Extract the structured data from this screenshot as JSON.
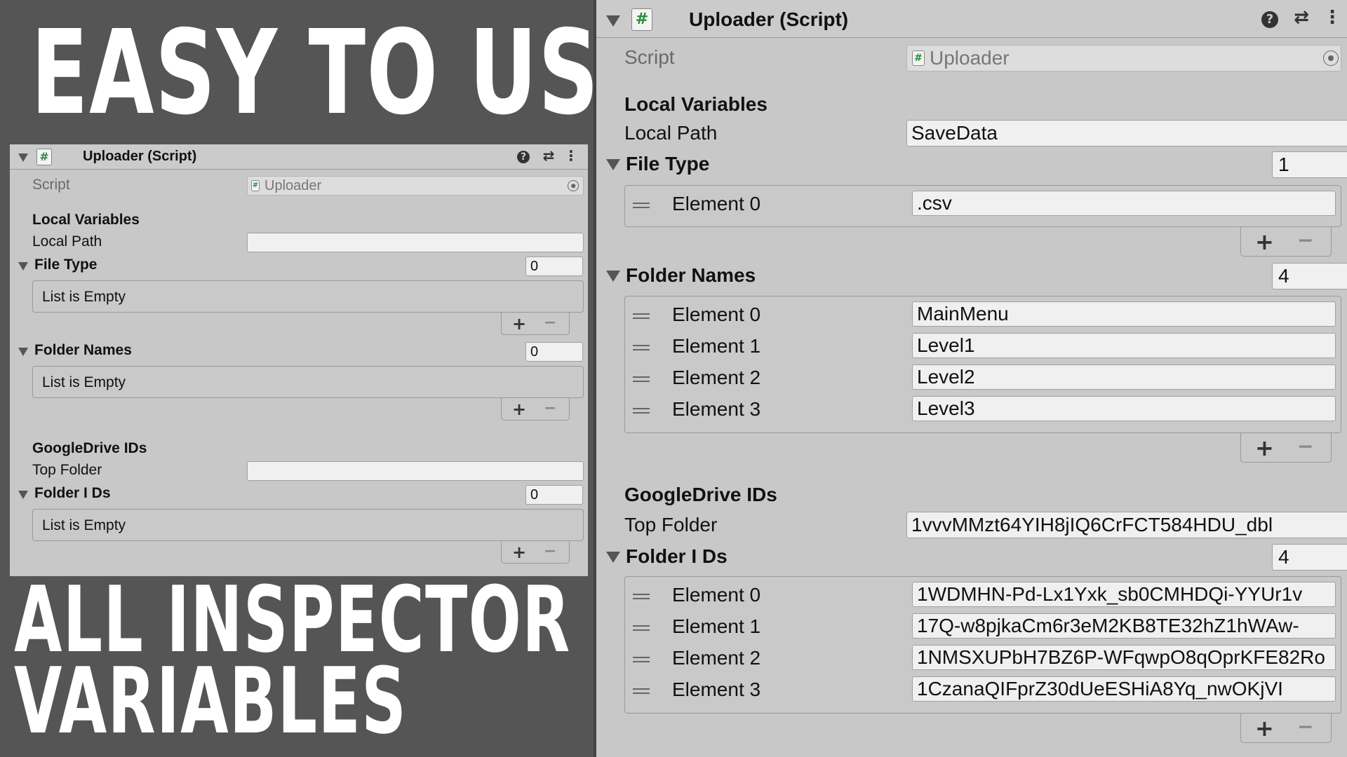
{
  "headline": {
    "line1": "EASY TO USE",
    "line2": "ALL INSPECTOR",
    "line3": "VARIABLES"
  },
  "small": {
    "component_title": "Uploader (Script)",
    "script_label": "Script",
    "script_value": "Uploader",
    "section_local": "Local Variables",
    "local_path_label": "Local Path",
    "local_path_value": "",
    "file_type_label": "File Type",
    "file_type_count": "0",
    "file_type_empty": "List is Empty",
    "folder_names_label": "Folder Names",
    "folder_names_count": "0",
    "folder_names_empty": "List is Empty",
    "section_drive": "GoogleDrive IDs",
    "top_folder_label": "Top Folder",
    "top_folder_value": "",
    "folder_ids_label": "Folder I Ds",
    "folder_ids_count": "0",
    "folder_ids_empty": "List is Empty",
    "plus": "+",
    "minus": "−"
  },
  "big": {
    "component_title": "Uploader (Script)",
    "script_label": "Script",
    "script_value": "Uploader",
    "section_local": "Local Variables",
    "local_path_label": "Local Path",
    "local_path_value": "SaveData",
    "file_type_label": "File Type",
    "file_type_count": "1",
    "file_type_elements": [
      {
        "label": "Element 0",
        "value": ".csv"
      }
    ],
    "folder_names_label": "Folder Names",
    "folder_names_count": "4",
    "folder_names_elements": [
      {
        "label": "Element 0",
        "value": "MainMenu"
      },
      {
        "label": "Element 1",
        "value": "Level1"
      },
      {
        "label": "Element 2",
        "value": "Level2"
      },
      {
        "label": "Element 3",
        "value": "Level3"
      }
    ],
    "section_drive": "GoogleDrive IDs",
    "top_folder_label": "Top Folder",
    "top_folder_value": "1vvvMMzt64YIH8jIQ6CrFCT584HDU_dbl",
    "folder_ids_label": "Folder I Ds",
    "folder_ids_count": "4",
    "folder_ids_elements": [
      {
        "label": "Element 0",
        "value": "1WDMHN-Pd-Lx1Yxk_sb0CMHDQi-YYUr1v"
      },
      {
        "label": "Element 1",
        "value": "17Q-w8pjkaCm6r3eM2KB8TE32hZ1hWAw-"
      },
      {
        "label": "Element 2",
        "value": "1NMSXUPbH7BZ6P-WFqwpO8qOprKFE82Ro"
      },
      {
        "label": "Element 3",
        "value": "1CzanaQIFprZ30dUeESHiA8Yq_nwOKjVI"
      }
    ],
    "plus": "+",
    "minus": "−"
  },
  "icons": {
    "help": "help-icon",
    "presets": "presets-icon",
    "menu": "kebab-menu-icon",
    "hash": "script-hash-icon",
    "target": "object-picker-icon",
    "drag": "drag-handle-icon"
  }
}
